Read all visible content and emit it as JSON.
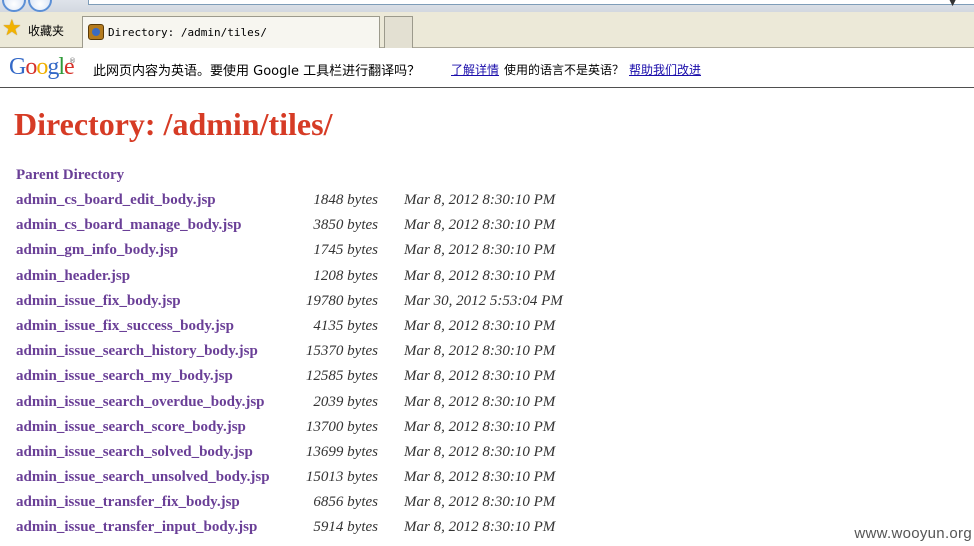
{
  "tabs": {
    "favorites_label": "收藏夹",
    "active_tab_title": "Directory: /admin/tiles/"
  },
  "google_toolbar": {
    "logo": "Google",
    "message": "此网页内容为英语。要使用 Google 工具栏进行翻译吗？",
    "learn_more": "了解详情",
    "not_english": "使用的语言不是英语？",
    "help_improve": "帮助我们改进"
  },
  "page": {
    "title": "Directory: /admin/tiles/",
    "parent_directory": "Parent Directory",
    "files": [
      {
        "name": "admin_cs_board_edit_body.jsp",
        "size": "1848 bytes",
        "date": "Mar 8, 2012 8:30:10 PM"
      },
      {
        "name": "admin_cs_board_manage_body.jsp",
        "size": "3850 bytes",
        "date": "Mar 8, 2012 8:30:10 PM"
      },
      {
        "name": "admin_gm_info_body.jsp",
        "size": "1745 bytes",
        "date": "Mar 8, 2012 8:30:10 PM"
      },
      {
        "name": "admin_header.jsp",
        "size": "1208 bytes",
        "date": "Mar 8, 2012 8:30:10 PM"
      },
      {
        "name": "admin_issue_fix_body.jsp",
        "size": "19780 bytes",
        "date": "Mar 30, 2012 5:53:04 PM"
      },
      {
        "name": "admin_issue_fix_success_body.jsp",
        "size": "4135 bytes",
        "date": "Mar 8, 2012 8:30:10 PM"
      },
      {
        "name": "admin_issue_search_history_body.jsp",
        "size": "15370 bytes",
        "date": "Mar 8, 2012 8:30:10 PM"
      },
      {
        "name": "admin_issue_search_my_body.jsp",
        "size": "12585 bytes",
        "date": "Mar 8, 2012 8:30:10 PM"
      },
      {
        "name": "admin_issue_search_overdue_body.jsp",
        "size": "2039 bytes",
        "date": "Mar 8, 2012 8:30:10 PM"
      },
      {
        "name": "admin_issue_search_score_body.jsp",
        "size": "13700 bytes",
        "date": "Mar 8, 2012 8:30:10 PM"
      },
      {
        "name": "admin_issue_search_solved_body.jsp",
        "size": "13699 bytes",
        "date": "Mar 8, 2012 8:30:10 PM"
      },
      {
        "name": "admin_issue_search_unsolved_body.jsp",
        "size": "15013 bytes",
        "date": "Mar 8, 2012 8:30:10 PM"
      },
      {
        "name": "admin_issue_transfer_fix_body.jsp",
        "size": "6856 bytes",
        "date": "Mar 8, 2012 8:30:10 PM"
      },
      {
        "name": "admin_issue_transfer_input_body.jsp",
        "size": "5914 bytes",
        "date": "Mar 8, 2012 8:30:10 PM"
      }
    ]
  },
  "watermark": "www.wooyun.org"
}
